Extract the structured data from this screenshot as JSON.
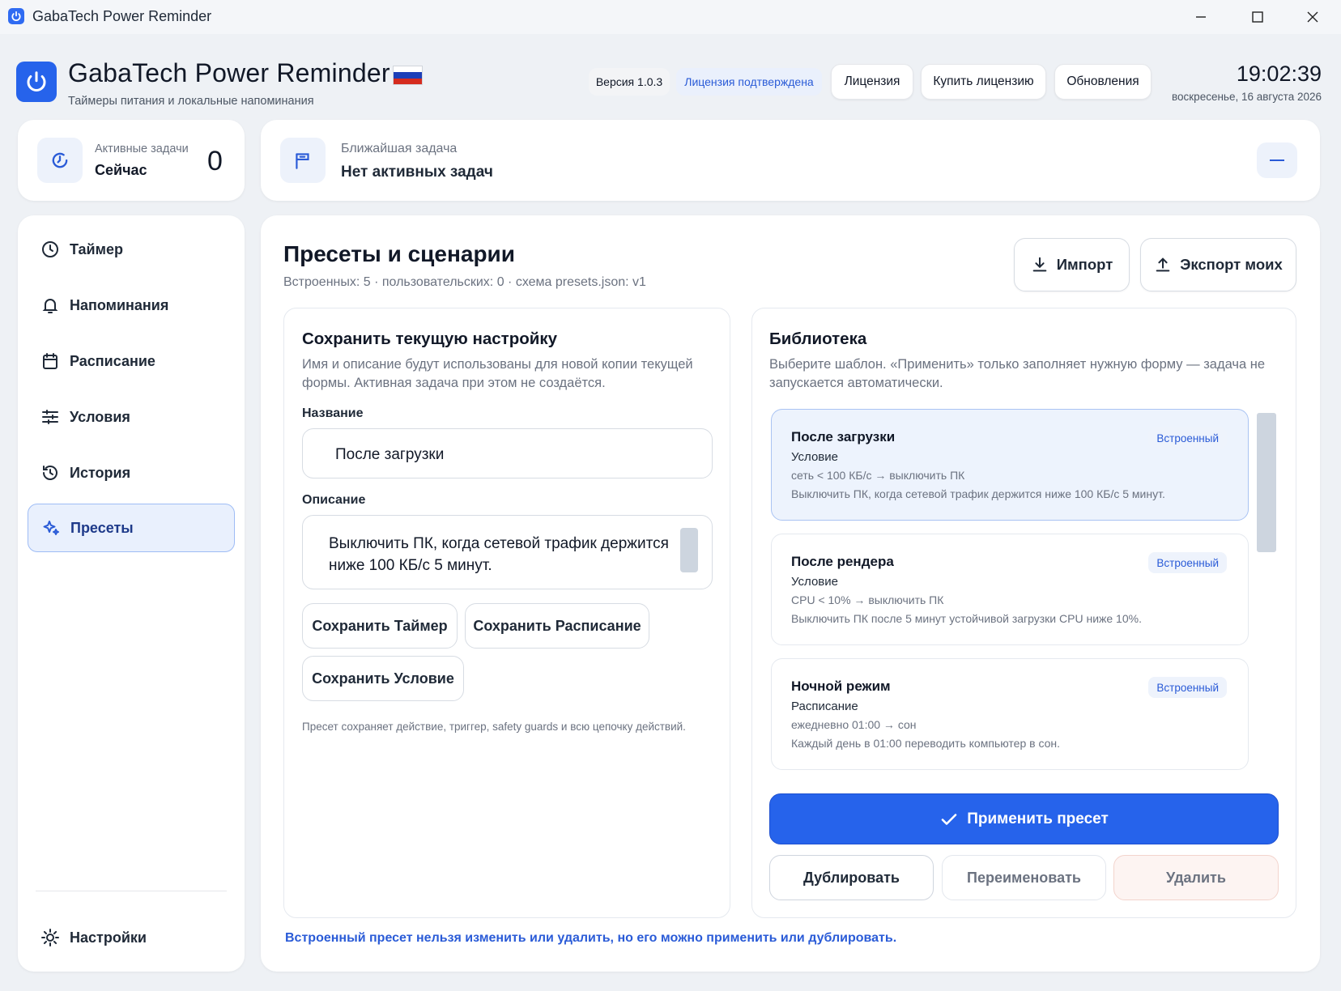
{
  "window": {
    "title": "GabaTech Power Reminder"
  },
  "header": {
    "app_name": "GabaTech Power Reminder",
    "subtitle": "Таймеры питания и локальные напоминания",
    "version": "Версия 1.0.3",
    "license_status": "Лицензия подтверждена",
    "license_btn": "Лицензия",
    "buy_btn": "Купить лицензию",
    "updates_btn": "Обновления",
    "time": "19:02:39",
    "date": "воскресенье, 16 августа 2026"
  },
  "status": {
    "active_label": "Активные задачи",
    "active_sub": "Сейчас",
    "active_count": "0",
    "next_label": "Ближайшая задача",
    "next_value": "Нет активных задач"
  },
  "sidebar": {
    "items": [
      {
        "label": "Таймер",
        "icon": "clock-icon"
      },
      {
        "label": "Напоминания",
        "icon": "bell-icon"
      },
      {
        "label": "Расписание",
        "icon": "calendar-icon"
      },
      {
        "label": "Условия",
        "icon": "sliders-icon"
      },
      {
        "label": "История",
        "icon": "history-icon"
      },
      {
        "label": "Пресеты",
        "icon": "sparkles-icon"
      }
    ],
    "active": "Пресеты",
    "settings": "Настройки"
  },
  "main": {
    "title": "Пресеты и сценарии",
    "subtitle": "Встроенных: 5 · пользовательских: 0 · схема presets.json: v1",
    "import_btn": "Импорт",
    "export_btn": "Экспорт моих",
    "save_panel": {
      "title": "Сохранить текущую настройку",
      "desc": "Имя и описание будут использованы для новой копии текущей формы. Активная задача при этом не создаётся.",
      "name_label": "Название",
      "name_value": "После загрузки",
      "desc_label": "Описание",
      "desc_value": "Выключить ПК, когда сетевой трафик держится ниже 100 КБ/с 5 минут.",
      "save_timer": "Сохранить Таймер",
      "save_schedule": "Сохранить Расписание",
      "save_condition": "Сохранить Условие",
      "note": "Пресет сохраняет действие, триггер, safety guards и всю цепочку действий."
    },
    "library": {
      "title": "Библиотека",
      "desc": "Выберите шаблон. «Применить» только заполняет нужную форму — задача не запускается автоматически.",
      "presets": [
        {
          "name": "После загрузки",
          "kind": "Условие",
          "rule": "сеть < 100 КБ/с → выключить ПК",
          "desc": "Выключить ПК, когда сетевой трафик держится ниже 100 КБ/с 5 минут.",
          "badge": "Встроенный"
        },
        {
          "name": "После рендера",
          "kind": "Условие",
          "rule": "CPU < 10% → выключить ПК",
          "desc": "Выключить ПК после 5 минут устойчивой загрузки CPU ниже 10%.",
          "badge": "Встроенный"
        },
        {
          "name": "Ночной режим",
          "kind": "Расписание",
          "rule": "ежедневно 01:00 → сон",
          "desc": "Каждый день в 01:00 переводить компьютер в сон.",
          "badge": "Встроенный"
        }
      ],
      "apply_btn": "Применить пресет",
      "duplicate_btn": "Дублировать",
      "rename_btn": "Переименовать",
      "delete_btn": "Удалить"
    },
    "footnote": "Встроенный пресет нельзя изменить или удалить, но его можно применить или дублировать."
  },
  "colors": {
    "accent": "#2663eb",
    "background": "#eef1f5",
    "selected": "#edf3fd"
  }
}
